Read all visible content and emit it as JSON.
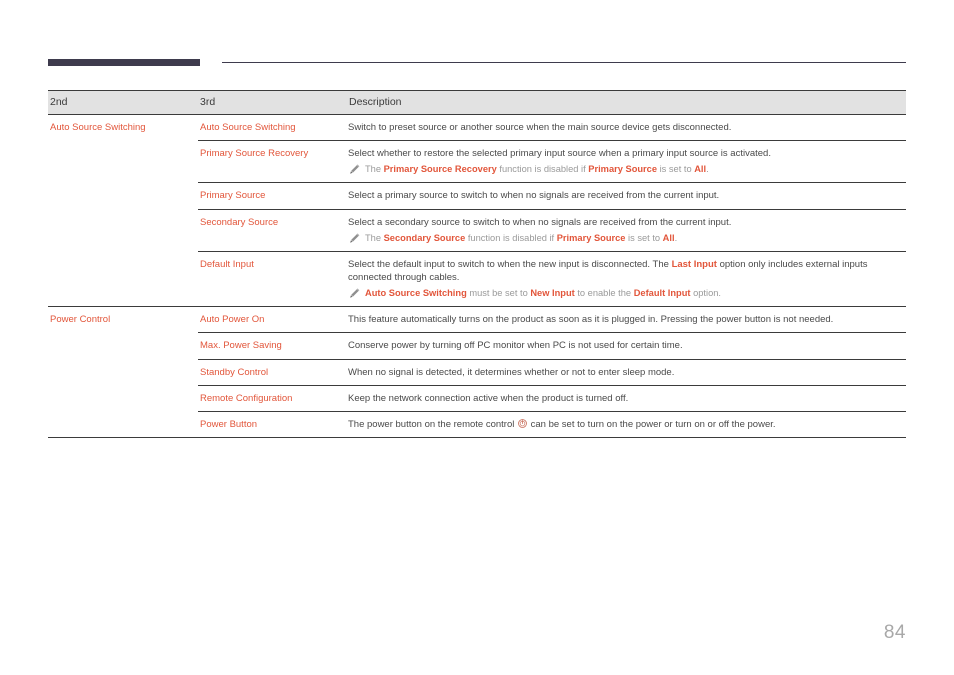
{
  "page": {
    "number": "84",
    "accent_color": "#e2563b",
    "rule_color": "#3e3b4d",
    "header_bg": "#e2e2e2",
    "note_color": "#9a9a9a"
  },
  "table": {
    "headers": {
      "col1": "2nd",
      "col2": "3rd",
      "col3": "Description"
    },
    "groups": [
      {
        "label": "Auto Source Switching",
        "rows": [
          {
            "name": "Auto Source Switching",
            "desc_parts": [
              {
                "t": "Switch to preset source or another source when the main source device gets disconnected.",
                "hl": false
              }
            ],
            "note": null
          },
          {
            "name": "Primary Source Recovery",
            "desc_parts": [
              {
                "t": "Select whether to restore the selected primary input source when a primary input source is activated.",
                "hl": false
              }
            ],
            "note": [
              {
                "t": "The ",
                "hl": false
              },
              {
                "t": "Primary Source Recovery",
                "hl": true
              },
              {
                "t": " function is disabled if ",
                "hl": false
              },
              {
                "t": "Primary Source",
                "hl": true
              },
              {
                "t": " is set to ",
                "hl": false
              },
              {
                "t": "All",
                "hl": true
              },
              {
                "t": ".",
                "hl": false
              }
            ]
          },
          {
            "name": "Primary Source",
            "desc_parts": [
              {
                "t": "Select a primary source to switch to when no signals are received from the current input.",
                "hl": false
              }
            ],
            "note": null
          },
          {
            "name": "Secondary Source",
            "desc_parts": [
              {
                "t": "Select a secondary source to switch to when no signals are received from the current input.",
                "hl": false
              }
            ],
            "note": [
              {
                "t": "The ",
                "hl": false
              },
              {
                "t": "Secondary Source",
                "hl": true
              },
              {
                "t": " function is disabled if ",
                "hl": false
              },
              {
                "t": "Primary Source",
                "hl": true
              },
              {
                "t": " is set to ",
                "hl": false
              },
              {
                "t": "All",
                "hl": true
              },
              {
                "t": ".",
                "hl": false
              }
            ]
          },
          {
            "name": "Default Input",
            "desc_parts": [
              {
                "t": "Select the default input to switch to when the new input is disconnected. The ",
                "hl": false
              },
              {
                "t": "Last Input",
                "hl": true
              },
              {
                "t": " option only includes external inputs connected through cables.",
                "hl": false
              }
            ],
            "note": [
              {
                "t": "Auto Source Switching",
                "hl": true
              },
              {
                "t": " must be set to ",
                "hl": false
              },
              {
                "t": "New Input",
                "hl": true
              },
              {
                "t": " to enable the ",
                "hl": false
              },
              {
                "t": "Default Input",
                "hl": true
              },
              {
                "t": " option.",
                "hl": false
              }
            ]
          }
        ]
      },
      {
        "label": "Power Control",
        "rows": [
          {
            "name": "Auto Power On",
            "desc_parts": [
              {
                "t": "This feature automatically turns on the product as soon as it is plugged in. Pressing the power button is not needed.",
                "hl": false
              }
            ],
            "note": null
          },
          {
            "name": "Max. Power Saving",
            "desc_parts": [
              {
                "t": "Conserve power by turning off PC monitor when PC is not used for certain time.",
                "hl": false
              }
            ],
            "note": null
          },
          {
            "name": "Standby Control",
            "desc_parts": [
              {
                "t": "When no signal is detected, it determines whether or not to enter sleep mode.",
                "hl": false
              }
            ],
            "note": null
          },
          {
            "name": "Remote Configuration",
            "desc_parts": [
              {
                "t": "Keep the network connection active when the product is turned off.",
                "hl": false
              }
            ],
            "note": null
          },
          {
            "name": "Power Button",
            "desc_parts": [
              {
                "t": "The power button on the remote control ",
                "hl": false
              },
              {
                "t": "@POWER_ICON@",
                "hl": false,
                "icon": "power-icon"
              },
              {
                "t": " can be set to turn on the power or turn on or off the power.",
                "hl": false
              }
            ],
            "note": null
          }
        ]
      }
    ]
  },
  "icons": {
    "note_icon": "pencil-icon",
    "remote_power_icon": "power-icon"
  }
}
